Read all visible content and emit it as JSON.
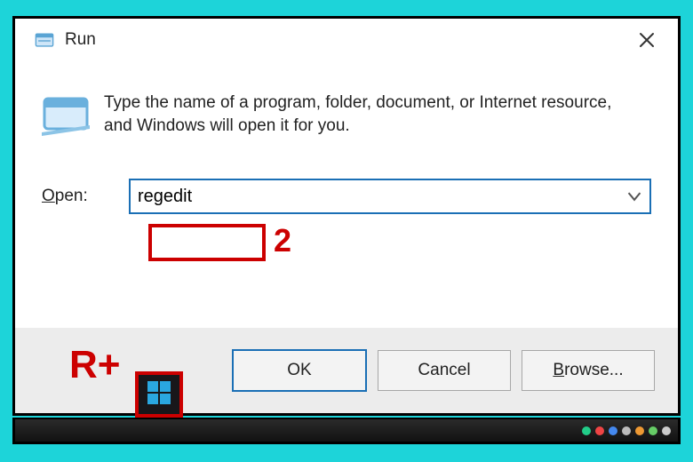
{
  "titlebar": {
    "title": "Run"
  },
  "body": {
    "info": "Type the name of a program, folder, document, or Internet resource, and Windows will open it for you.",
    "open_label_pre": "O",
    "open_label_rest": "pen:",
    "combo_value": "regedit"
  },
  "footer": {
    "ok": "OK",
    "cancel": "Cancel",
    "browse_pre": "B",
    "browse_rest": "rowse..."
  },
  "annotations": {
    "step2": "2",
    "rplus": "R+"
  },
  "icons": {
    "title_icon": "run-icon",
    "body_icon": "run-icon-large",
    "close": "close-icon",
    "chevron": "chevron-down-icon",
    "start": "windows-start-icon"
  },
  "colors": {
    "accent": "#1a6fb5",
    "annotation": "#c00"
  }
}
